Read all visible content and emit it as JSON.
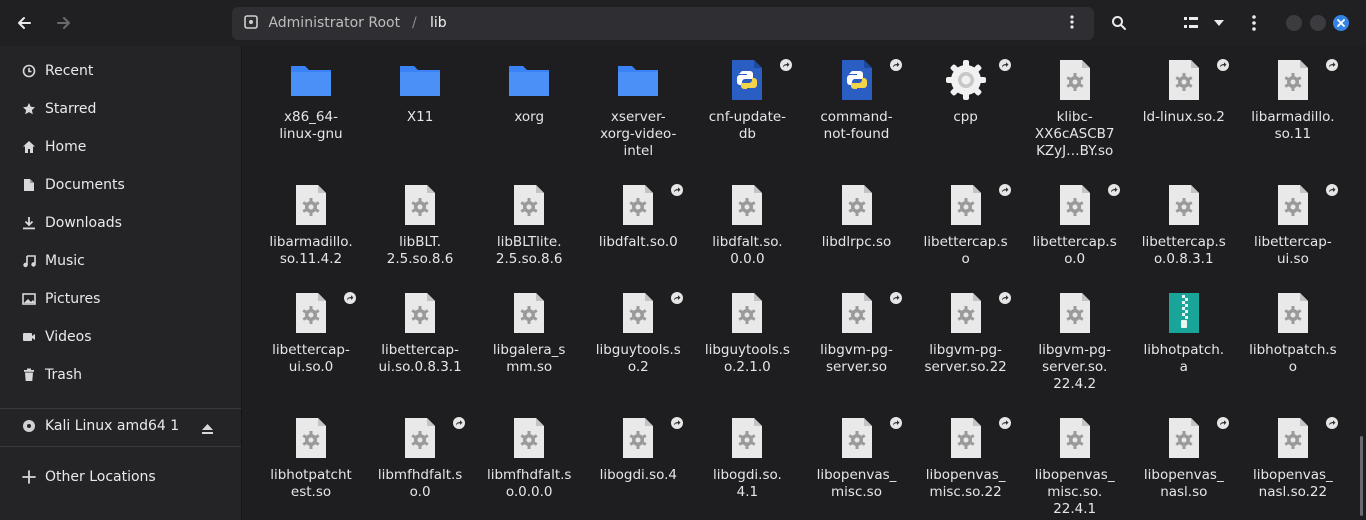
{
  "header": {
    "path_root": "Administrator Root",
    "path_sep": "/",
    "path_current": "lib",
    "icons": [
      "back-icon",
      "forward-icon",
      "hard-drive-icon",
      "more-vert-icon",
      "search-icon",
      "list-view-icon",
      "chevron-down-icon",
      "kebab-menu-icon",
      "minimize-icon",
      "maximize-icon",
      "close-icon"
    ]
  },
  "sidebar": {
    "places": [
      {
        "label": "Recent",
        "icon": "clock-icon"
      },
      {
        "label": "Starred",
        "icon": "star-icon"
      },
      {
        "label": "Home",
        "icon": "home-icon"
      },
      {
        "label": "Documents",
        "icon": "document-icon"
      },
      {
        "label": "Downloads",
        "icon": "download-icon"
      },
      {
        "label": "Music",
        "icon": "music-icon"
      },
      {
        "label": "Pictures",
        "icon": "picture-icon"
      },
      {
        "label": "Videos",
        "icon": "video-icon"
      },
      {
        "label": "Trash",
        "icon": "trash-icon"
      }
    ],
    "devices": [
      {
        "label": "Kali Linux amd64 1",
        "icon": "disc-icon",
        "eject": "eject-icon"
      }
    ],
    "other": {
      "label": "Other Locations",
      "icon": "plus-icon"
    }
  },
  "files": [
    [
      {
        "name": "x86_64-\nlinux-gnu",
        "kind": "folder",
        "link": false
      },
      {
        "name": "X11",
        "kind": "folder",
        "link": false
      },
      {
        "name": "xorg",
        "kind": "folder",
        "link": false
      },
      {
        "name": "xserver-\nxorg-video-\nintel",
        "kind": "folder",
        "link": false
      },
      {
        "name": "cnf-update-\ndb",
        "kind": "python",
        "link": true
      },
      {
        "name": "command-\nnot-found",
        "kind": "python",
        "link": true
      },
      {
        "name": "cpp",
        "kind": "gear",
        "link": true
      },
      {
        "name": "klibc-\nXX6cASCB7\nKZyJ…BY.so",
        "kind": "lib",
        "link": false
      },
      {
        "name": "ld-linux.so.2",
        "kind": "lib",
        "link": true
      },
      {
        "name": "libarmadillo.\nso.11",
        "kind": "lib",
        "link": true
      }
    ],
    [
      {
        "name": "libarmadillo.\nso.11.4.2",
        "kind": "lib",
        "link": false
      },
      {
        "name": "libBLT.\n2.5.so.8.6",
        "kind": "lib",
        "link": false
      },
      {
        "name": "libBLTlite.\n2.5.so.8.6",
        "kind": "lib",
        "link": false
      },
      {
        "name": "libdfalt.so.0",
        "kind": "lib",
        "link": true
      },
      {
        "name": "libdfalt.so.\n0.0.0",
        "kind": "lib",
        "link": false
      },
      {
        "name": "libdlrpc.so",
        "kind": "lib",
        "link": false
      },
      {
        "name": "libettercap.s\no",
        "kind": "lib",
        "link": true
      },
      {
        "name": "libettercap.s\no.0",
        "kind": "lib",
        "link": true
      },
      {
        "name": "libettercap.s\no.0.8.3.1",
        "kind": "lib",
        "link": false
      },
      {
        "name": "libettercap-\nui.so",
        "kind": "lib",
        "link": true
      }
    ],
    [
      {
        "name": "libettercap-\nui.so.0",
        "kind": "lib",
        "link": true
      },
      {
        "name": "libettercap-\nui.so.0.8.3.1",
        "kind": "lib",
        "link": false
      },
      {
        "name": "libgalera_s\nmm.so",
        "kind": "lib",
        "link": false
      },
      {
        "name": "libguytools.s\no.2",
        "kind": "lib",
        "link": true
      },
      {
        "name": "libguytools.s\no.2.1.0",
        "kind": "lib",
        "link": false
      },
      {
        "name": "libgvm-pg-\nserver.so",
        "kind": "lib",
        "link": true
      },
      {
        "name": "libgvm-pg-\nserver.so.22",
        "kind": "lib",
        "link": true
      },
      {
        "name": "libgvm-pg-\nserver.so.\n22.4.2",
        "kind": "lib",
        "link": false
      },
      {
        "name": "libhotpatch.\na",
        "kind": "archive",
        "link": false
      },
      {
        "name": "libhotpatch.s\no",
        "kind": "lib",
        "link": false
      }
    ],
    [
      {
        "name": "libhotpatcht\nest.so",
        "kind": "lib",
        "link": false
      },
      {
        "name": "libmfhdfalt.s\no.0",
        "kind": "lib",
        "link": true
      },
      {
        "name": "libmfhdfalt.s\no.0.0.0",
        "kind": "lib",
        "link": false
      },
      {
        "name": "libogdi.so.4",
        "kind": "lib",
        "link": true
      },
      {
        "name": "libogdi.so.\n4.1",
        "kind": "lib",
        "link": false
      },
      {
        "name": "libopenvas_\nmisc.so",
        "kind": "lib",
        "link": true
      },
      {
        "name": "libopenvas_\nmisc.so.22",
        "kind": "lib",
        "link": true
      },
      {
        "name": "libopenvas_\nmisc.so.\n22.4.1",
        "kind": "lib",
        "link": false
      },
      {
        "name": "libopenvas_\nnasl.so",
        "kind": "lib",
        "link": true
      },
      {
        "name": "libopenvas_\nnasl.so.22",
        "kind": "lib",
        "link": true
      }
    ]
  ],
  "colors": {
    "folder": "#3b82f6",
    "python": "#2a5ec2",
    "accent": "#3584e4",
    "archive": "#1aa59a"
  }
}
